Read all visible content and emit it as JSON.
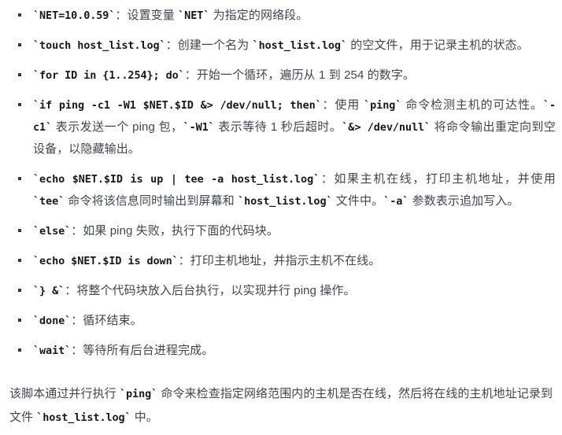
{
  "document": {
    "language": "zh-CN",
    "colors": {
      "background": "#ffffff",
      "body_text": "#3f4650",
      "code_text": "#14181f",
      "bullet_marker": "#2f3640"
    },
    "list": {
      "marker": "square-bullet",
      "items": [
        {
          "id": "net-var",
          "code": "`NET=10.0.59`",
          "text_before_inline": "：设置变量 ",
          "inline_code": "`NET`",
          "text_after_inline": " 为指定的网络段。",
          "plain": "`NET=10.0.59`：设置变量 `NET` 为指定的网络段。"
        },
        {
          "id": "touch-logfile",
          "code": "`touch host_list.log`",
          "text_before_inline": "：创建一个名为 ",
          "inline_code": "`host_list.log`",
          "text_after_inline": " 的空文件，用于记录主机的状态。",
          "plain": "`touch host_list.log`：创建一个名为 `host_list.log` 的空文件，用于记录主机的状态。"
        },
        {
          "id": "for-loop",
          "code": "`for ID in {1..254}; do`",
          "text_after_inline": "：开始一个循环，遍历从 1 到 254 的数字。",
          "plain": "`for ID in {1..254}; do`：开始一个循环，遍历从 1 到 254 的数字。"
        },
        {
          "id": "if-ping",
          "code": "`if ping -c1 -W1 $NET.$ID &> /dev/null; then`",
          "segments": [
            {
              "type": "cn",
              "value": "：使用 "
            },
            {
              "type": "code",
              "value": "`ping`"
            },
            {
              "type": "cn",
              "value": " 命令检测主机的可达性。"
            },
            {
              "type": "code",
              "value": "`-c1`"
            },
            {
              "type": "cn",
              "value": " 表示发送一个 ping 包，"
            },
            {
              "type": "code",
              "value": "`-W1`"
            },
            {
              "type": "cn",
              "value": " 表示等待 1 秒后超时。"
            },
            {
              "type": "code",
              "value": "`&> /dev/null`"
            },
            {
              "type": "cn",
              "value": " 将命令输出重定向到空设备，以隐藏输出。"
            }
          ]
        },
        {
          "id": "echo-up-tee",
          "code": "`echo $NET.$ID is up | tee -a host_list.log`",
          "segments": [
            {
              "type": "cn",
              "value": "：如果主机在线，打印主机地址，并使用 "
            },
            {
              "type": "code",
              "value": "`tee`"
            },
            {
              "type": "cn",
              "value": " 命令将该信息同时输出到屏幕和 "
            },
            {
              "type": "code",
              "value": "`host_list.log`"
            },
            {
              "type": "cn",
              "value": " 文件中。"
            },
            {
              "type": "code",
              "value": "`-a`"
            },
            {
              "type": "cn",
              "value": " 参数表示追加写入。"
            }
          ]
        },
        {
          "id": "else-branch",
          "code": "`else`",
          "text_after_inline": "：如果 ping 失败，执行下面的代码块。",
          "plain": "`else`：如果 ping 失败，执行下面的代码块。"
        },
        {
          "id": "echo-down",
          "code": "`echo $NET.$ID is down`",
          "text_after_inline": "：打印主机地址，并指示主机不在线。",
          "plain": "`echo $NET.$ID is down`：打印主机地址，并指示主机不在线。"
        },
        {
          "id": "background-block",
          "code": "`} &`",
          "text_after_inline": "：将整个代码块放入后台执行，以实现并行 ping 操作。",
          "plain": "`} &`：将整个代码块放入后台执行，以实现并行 ping 操作。"
        },
        {
          "id": "done-keyword",
          "code": "`done`",
          "text_after_inline": "：循环结束。",
          "plain": "`done`：循环结束。"
        },
        {
          "id": "wait-keyword",
          "code": "`wait`",
          "text_after_inline": "：等待所有后台进程完成。",
          "plain": "`wait`：等待所有后台进程完成。"
        }
      ]
    },
    "summary": {
      "segments": [
        {
          "type": "cn",
          "value": "该脚本通过并行执行 "
        },
        {
          "type": "code",
          "value": "`ping`"
        },
        {
          "type": "cn",
          "value": " 命令来检查指定网络范围内的主机是否在线，然后将在线的主机地址记录到文件 "
        },
        {
          "type": "code",
          "value": "`host_list.log`"
        },
        {
          "type": "cn",
          "value": " 中。"
        }
      ],
      "plain": "该脚本通过并行执行 `ping` 命令来检查指定网络范围内的主机是否在线，然后将在线的主机地址记录到文件 `host_list.log` 中。"
    }
  }
}
